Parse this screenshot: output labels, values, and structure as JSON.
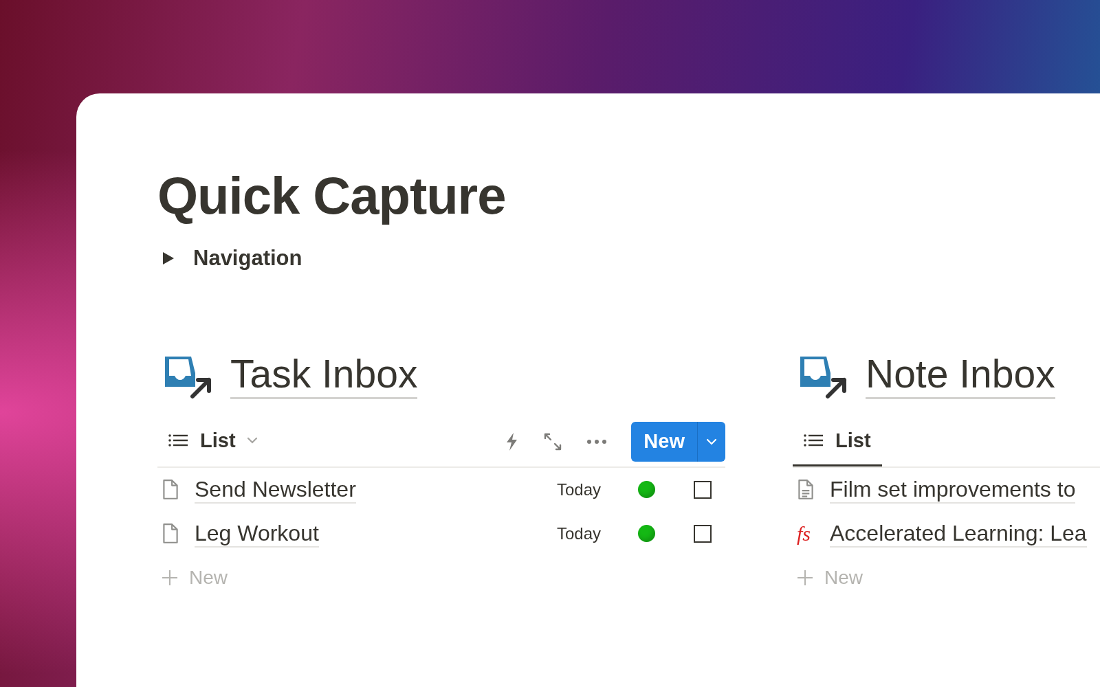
{
  "page": {
    "title": "Quick Capture"
  },
  "toggle": {
    "label": "Navigation",
    "expanded": false
  },
  "databases": [
    {
      "title": "Task Inbox",
      "view": {
        "label": "List",
        "selected": false
      },
      "new_button": {
        "label": "New"
      },
      "add_label": "New",
      "rows": [
        {
          "kind": "task",
          "title": "Send Newsletter",
          "date": "Today",
          "color": "#14b814",
          "checked": false
        },
        {
          "kind": "task",
          "title": "Leg Workout",
          "date": "Today",
          "color": "#14b814",
          "checked": false
        }
      ]
    },
    {
      "title": "Note Inbox",
      "view": {
        "label": "List",
        "selected": true
      },
      "add_label": "New",
      "rows": [
        {
          "kind": "note",
          "title": "Film set improvements to"
        },
        {
          "kind": "logo",
          "icon_text": "fs",
          "title": "Accelerated Learning: Lea"
        }
      ]
    }
  ]
}
